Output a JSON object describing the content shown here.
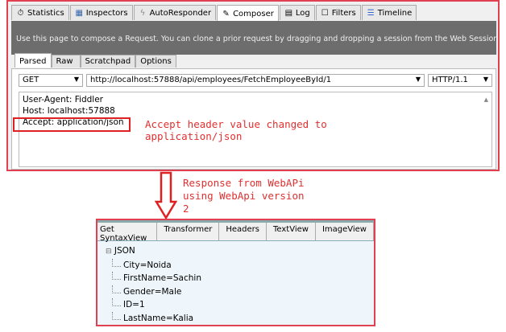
{
  "tabs": [
    {
      "label": "Statistics",
      "icon": "stopwatch-icon"
    },
    {
      "label": "Inspectors",
      "icon": "inspect-icon"
    },
    {
      "label": "AutoResponder",
      "icon": "lightning-icon"
    },
    {
      "label": "Composer",
      "icon": "compose-icon"
    },
    {
      "label": "Log",
      "icon": "log-icon"
    },
    {
      "label": "Filters",
      "icon": "checkbox-icon"
    },
    {
      "label": "Timeline",
      "icon": "timeline-icon"
    }
  ],
  "banner": "Use this page to compose a Request. You can clone a prior request by dragging and dropping a session from the Web Sessions list",
  "request_tabs": [
    "Parsed",
    "Raw",
    "Scratchpad",
    "Options"
  ],
  "method": "GET",
  "url": "http://localhost:57888/api/employees/FetchEmployeeById/1",
  "version": "HTTP/1.1",
  "headers": [
    "User-Agent: Fiddler",
    "Host: localhost:57888",
    "Accept: application/json"
  ],
  "annotation1": [
    "Accept header value changed to",
    "application/json"
  ],
  "annotation2": [
    "Response from WebAPi",
    "using WebApi version",
    "2"
  ],
  "response_tabs": [
    "Get SyntaxView",
    "Transformer",
    "Headers",
    "TextView",
    "ImageView"
  ],
  "tree": {
    "root": "JSON",
    "items": [
      "City=Noida",
      "FirstName=Sachin",
      "Gender=Male",
      "ID=1",
      "LastName=Kalia"
    ]
  }
}
